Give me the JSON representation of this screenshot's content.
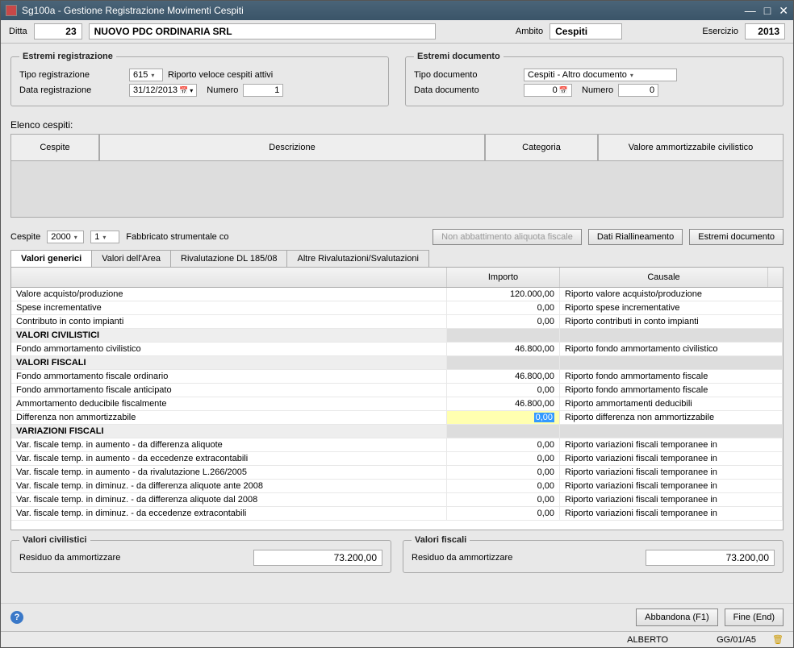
{
  "titlebar": {
    "title": "Sg100a - Gestione Registrazione Movimenti Cespiti"
  },
  "header": {
    "ditta_label": "Ditta",
    "ditta_value": "23",
    "company": "NUOVO PDC ORDINARIA SRL",
    "ambito_label": "Ambito",
    "ambito_value": "Cespiti",
    "esercizio_label": "Esercizio",
    "esercizio_value": "2013"
  },
  "estremi_reg": {
    "legend": "Estremi registrazione",
    "tipo_label": "Tipo registrazione",
    "tipo_value": "615",
    "tipo_desc": "Riporto veloce cespiti attivi",
    "data_label": "Data registrazione",
    "data_value": "31/12/2013",
    "numero_label": "Numero",
    "numero_value": "1"
  },
  "estremi_doc": {
    "legend": "Estremi documento",
    "tipo_label": "Tipo documento",
    "tipo_value": "Cespiti - Altro documento",
    "data_label": "Data documento",
    "data_value": "0",
    "numero_label": "Numero",
    "numero_value": "0"
  },
  "elenco": {
    "label": "Elenco cespiti:",
    "cols": [
      "Cespite",
      "Descrizione",
      "Categoria",
      "Valore ammortizzabile civilistico"
    ]
  },
  "cespite": {
    "label": "Cespite",
    "code": "2000",
    "seq": "1",
    "desc": "Fabbricato strumentale co",
    "btn_non_abbatt": "Non abbattimento aliquota fiscale",
    "btn_riall": "Dati Riallineamento",
    "btn_estremi": "Estremi documento"
  },
  "tabs": [
    "Valori generici",
    "Valori dell'Area",
    "Rivalutazione DL 185/08",
    "Altre Rivalutazioni/Svalutazioni"
  ],
  "grid": {
    "cols": [
      "",
      "Importo",
      "Causale"
    ],
    "rows": [
      {
        "t": "row",
        "d": "Valore acquisto/produzione",
        "i": "120.000,00",
        "c": "Riporto valore acquisto/produzione"
      },
      {
        "t": "row",
        "d": "Spese incrementative",
        "i": "0,00",
        "c": "Riporto spese incrementative"
      },
      {
        "t": "row",
        "d": "Contributo in conto impianti",
        "i": "0,00",
        "c": "Riporto contributi in conto impianti"
      },
      {
        "t": "section",
        "d": "VALORI CIVILISTICI"
      },
      {
        "t": "row",
        "d": "Fondo ammortamento civilistico",
        "i": "46.800,00",
        "c": "Riporto fondo ammortamento civilistico"
      },
      {
        "t": "section",
        "d": "VALORI FISCALI"
      },
      {
        "t": "row",
        "d": "Fondo ammortamento fiscale ordinario",
        "i": "46.800,00",
        "c": "Riporto fondo ammortamento fiscale"
      },
      {
        "t": "row",
        "d": "Fondo ammortamento fiscale anticipato",
        "i": "0,00",
        "c": "Riporto fondo ammortamento fiscale"
      },
      {
        "t": "row",
        "d": "Ammortamento deducibile fiscalmente",
        "i": "46.800,00",
        "c": "Riporto ammortamenti deducibili"
      },
      {
        "t": "hl",
        "d": "Differenza non ammortizzabile",
        "i": "0,00",
        "c": "Riporto differenza non ammortizzabile"
      },
      {
        "t": "section",
        "d": "VARIAZIONI FISCALI"
      },
      {
        "t": "row",
        "d": "Var. fiscale temp. in aumento - da differenza aliquote",
        "i": "0,00",
        "c": "Riporto variazioni fiscali temporanee in"
      },
      {
        "t": "row",
        "d": "Var. fiscale temp. in aumento - da eccedenze extracontabili",
        "i": "0,00",
        "c": "Riporto variazioni fiscali temporanee in"
      },
      {
        "t": "row",
        "d": "Var. fiscale temp. in aumento - da rivalutazione L.266/2005",
        "i": "0,00",
        "c": "Riporto variazioni fiscali temporanee in"
      },
      {
        "t": "row",
        "d": "Var. fiscale temp. in diminuz. - da differenza aliquote ante 2008",
        "i": "0,00",
        "c": "Riporto variazioni fiscali temporanee in"
      },
      {
        "t": "row",
        "d": "Var. fiscale temp. in diminuz. - da differenza aliquote dal 2008",
        "i": "0,00",
        "c": "Riporto variazioni fiscali temporanee in"
      },
      {
        "t": "row",
        "d": "Var. fiscale temp. in diminuz. - da eccedenze extracontabili",
        "i": "0,00",
        "c": "Riporto variazioni fiscali temporanee in"
      }
    ]
  },
  "valori_civ": {
    "legend": "Valori civilistici",
    "residuo_label": "Residuo da ammortizzare",
    "residuo_value": "73.200,00"
  },
  "valori_fis": {
    "legend": "Valori fiscali",
    "residuo_label": "Residuo da ammortizzare",
    "residuo_value": "73.200,00"
  },
  "footer": {
    "abbandona": "Abbandona (F1)",
    "fine": "Fine (End)"
  },
  "statusbar": {
    "user": "ALBERTO",
    "code": "GG/01/A5"
  }
}
